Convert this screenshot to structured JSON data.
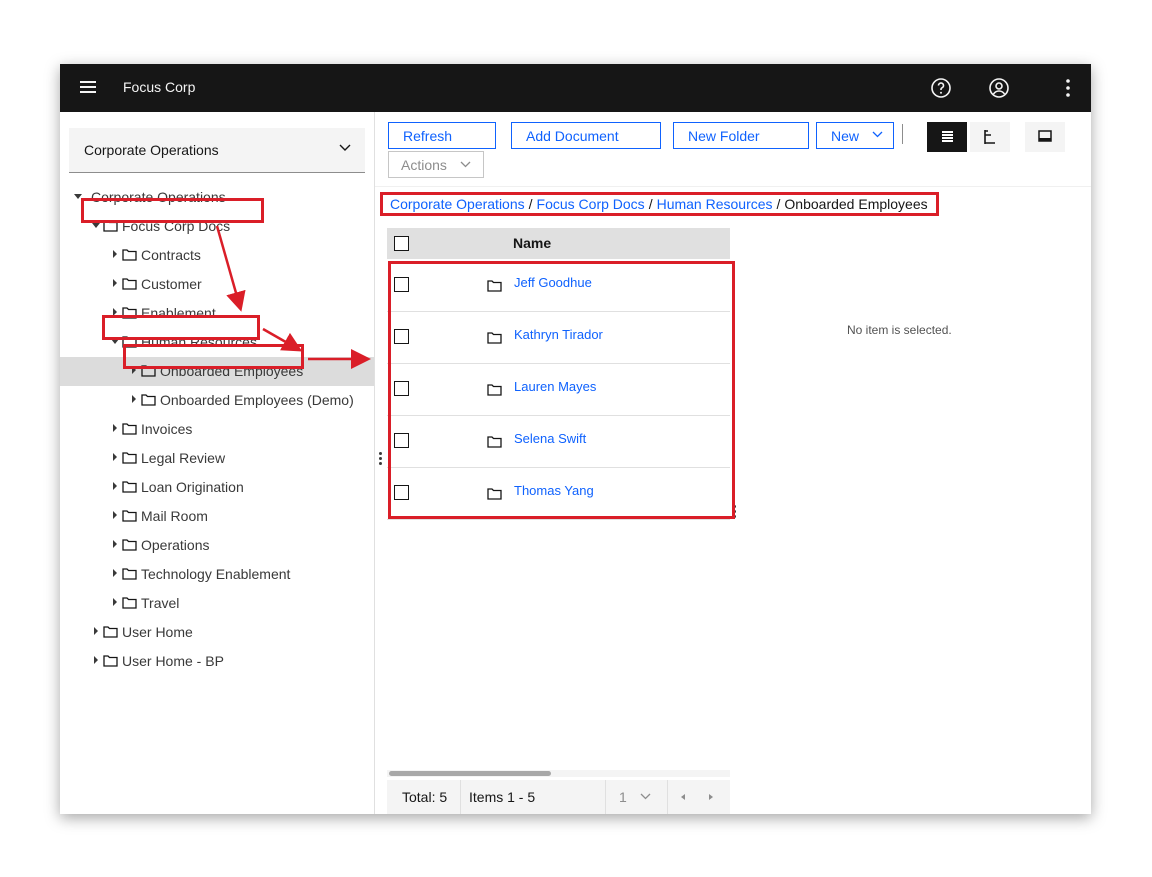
{
  "app": {
    "title": "Focus Corp"
  },
  "header_icons": [
    "hamburger-menu-icon",
    "help-icon",
    "user-icon",
    "overflow-menu-icon"
  ],
  "repository_select": {
    "value": "Corporate Operations"
  },
  "tree": {
    "root": "Corporate Operations",
    "items": [
      "Focus Corp Docs",
      "Contracts",
      "Customer",
      "Enablement",
      "Human Resources",
      "Onboarded Employees",
      "Onboarded Employees (Demo)",
      "Invoices",
      "Legal Review",
      "Loan Origination",
      "Mail Room",
      "Operations",
      "Technology Enablement",
      "Travel",
      "User Home",
      "User Home - BP"
    ],
    "selected": "Onboarded Employees"
  },
  "toolbar": {
    "refresh": "Refresh",
    "add_document": "Add Document",
    "new_folder": "New Folder",
    "new": "New",
    "actions": "Actions",
    "view_modes": [
      "details-view-icon",
      "tree-view-icon",
      "magazine-view-icon"
    ]
  },
  "breadcrumb": {
    "items": [
      "Corporate Operations",
      "Focus Corp Docs",
      "Human Resources"
    ],
    "current": "Onboarded Employees",
    "separator": "/"
  },
  "grid": {
    "header": "Name",
    "rows": [
      "Jeff Goodhue",
      "Kathryn Tirador",
      "Lauren Mayes",
      "Selena Swift",
      "Thomas Yang"
    ]
  },
  "details_panel": {
    "message": "No item is selected."
  },
  "pagination": {
    "total": "Total: 5",
    "items": "Items 1 - 5",
    "page": "1"
  },
  "colors": {
    "link": "#0f62fe",
    "header_bg": "#161616",
    "highlight": "#da1e28"
  }
}
